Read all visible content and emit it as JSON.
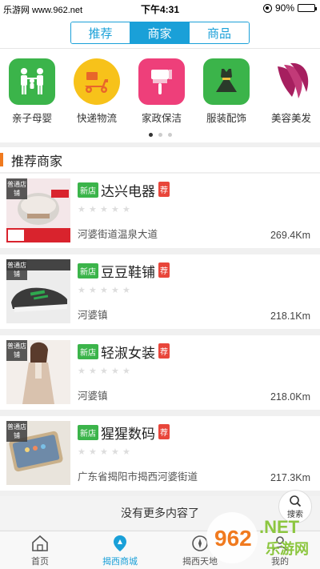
{
  "status": {
    "site": "乐游网 www.962.net",
    "time": "下午4:31",
    "battery": "90%"
  },
  "top_tabs": [
    "推荐",
    "商家",
    "商品"
  ],
  "categories": [
    {
      "label": "亲子母婴",
      "icon": "family-icon",
      "color": "#3bb44a"
    },
    {
      "label": "快递物流",
      "icon": "delivery-scooter-icon",
      "color": "#f7c21a"
    },
    {
      "label": "家政保洁",
      "icon": "cleaning-brush-icon",
      "color": "#ee3f7a"
    },
    {
      "label": "服装配饰",
      "icon": "dress-icon",
      "color": "#3bb44a"
    },
    {
      "label": "美容美发",
      "icon": "beauty-face-icon",
      "color": "#a61f5f"
    }
  ],
  "section_title": "推荐商家",
  "shops": [
    {
      "thumb_tag": "普通店铺",
      "new": "新店",
      "name": "达兴电器",
      "rec": "荐",
      "address": "河婆街道温泉大道",
      "distance": "269.4Km"
    },
    {
      "thumb_tag": "普通店铺",
      "new": "新店",
      "name": "豆豆鞋铺",
      "rec": "荐",
      "address": "河婆镇",
      "distance": "218.1Km"
    },
    {
      "thumb_tag": "普通店铺",
      "new": "新店",
      "name": "轻淑女装",
      "rec": "荐",
      "address": "河婆镇",
      "distance": "218.0Km"
    },
    {
      "thumb_tag": "普通店铺",
      "new": "新店",
      "name": "猩猩数码",
      "rec": "荐",
      "address": "广东省揭阳市揭西河婆街道",
      "distance": "217.3Km"
    }
  ],
  "no_more": "没有更多内容了",
  "search_fab": "搜索",
  "tabbar": [
    {
      "label": "首页",
      "icon": "home-icon"
    },
    {
      "label": "揭西商城",
      "icon": "map-pin-icon"
    },
    {
      "label": "揭西天地",
      "icon": "compass-icon"
    },
    {
      "label": "我的",
      "icon": "user-icon"
    }
  ],
  "watermark": "962.NET 乐游网",
  "colors": {
    "accent": "#1aa0d8",
    "section_bar": "#f07a1f",
    "new_tag": "#3bb44a",
    "rec_tag": "#e8463b"
  }
}
